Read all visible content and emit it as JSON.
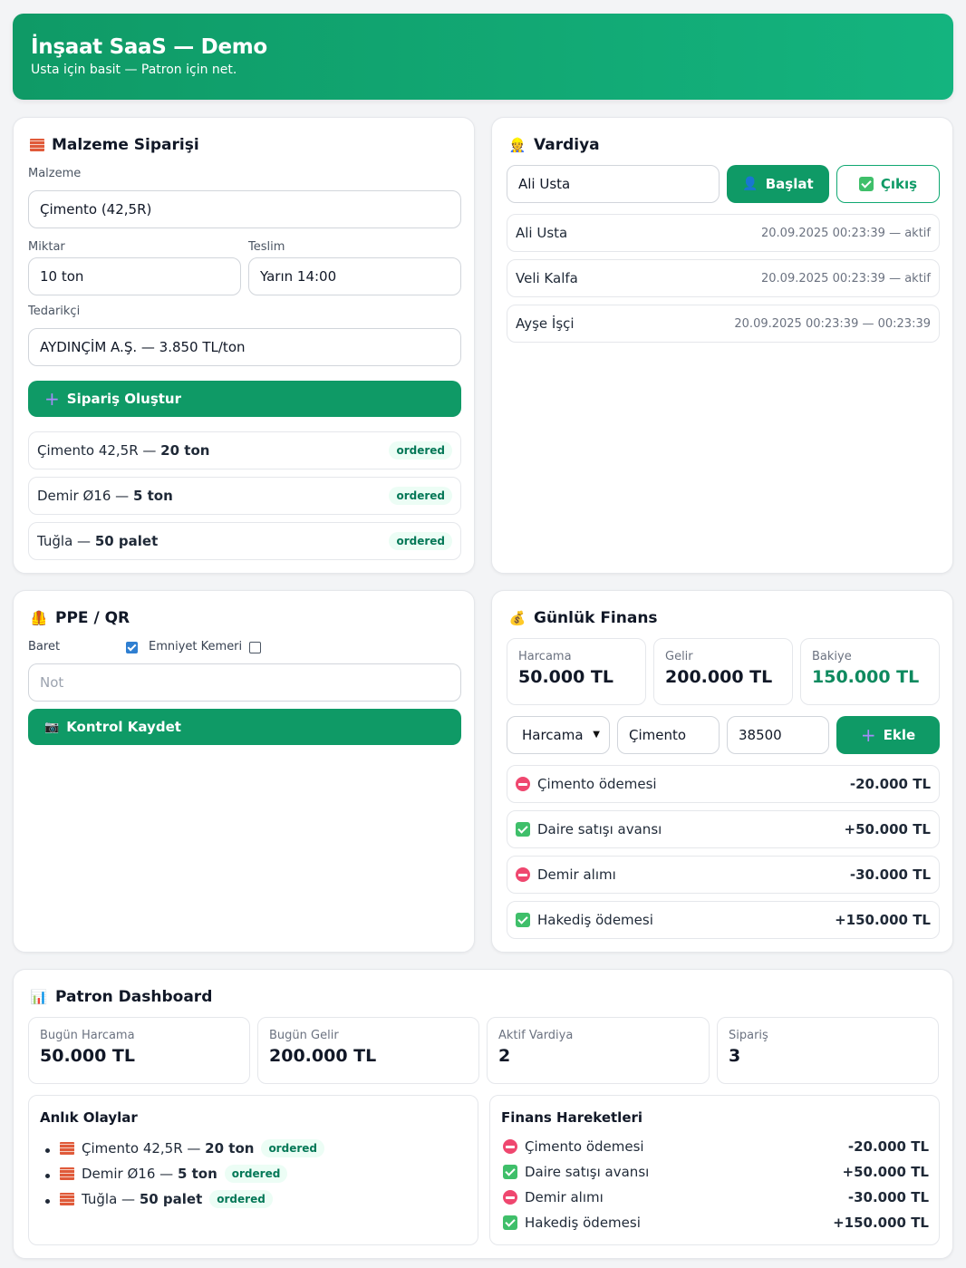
{
  "header": {
    "title": "İnşaat SaaS — Demo",
    "subtitle": "Usta için basit — Patron için net."
  },
  "order": {
    "title": "Malzeme Siparişi",
    "material_label": "Malzeme",
    "material_value": "Çimento (42,5R)",
    "qty_label": "Miktar",
    "qty_value": "10 ton",
    "delivery_label": "Teslim",
    "delivery_value": "Yarın 14:00",
    "supplier_label": "Tedarikçi",
    "supplier_value": "AYDINÇİM A.Ş. — 3.850 TL/ton",
    "create_button": "Sipariş Oluştur",
    "items": [
      {
        "name": "Çimento 42,5R — ",
        "qty": "20 ton",
        "status": "ordered"
      },
      {
        "name": "Demir Ø16 — ",
        "qty": "5 ton",
        "status": "ordered"
      },
      {
        "name": "Tuğla — ",
        "qty": "50 palet",
        "status": "ordered"
      }
    ]
  },
  "shift": {
    "title": "Vardiya",
    "name_value": "Ali Usta",
    "start_button": "Başlat",
    "exit_button": "Çıkış",
    "entries": [
      {
        "name": "Ali Usta",
        "time": "20.09.2025 00:23:39 — aktif"
      },
      {
        "name": "Veli Kalfa",
        "time": "20.09.2025 00:23:39 — aktif"
      },
      {
        "name": "Ayşe İşçi",
        "time": "20.09.2025 00:23:39 — 00:23:39"
      }
    ]
  },
  "ppe": {
    "title": "PPE / QR",
    "helmet_label": "Baret",
    "belt_label": "Emniyet Kemeri",
    "note_placeholder": "Not",
    "save_button": "Kontrol Kaydet"
  },
  "finance": {
    "title": "Günlük Finans",
    "expense_label": "Harcama",
    "expense_value": "50.000 TL",
    "income_label": "Gelir",
    "income_value": "200.000 TL",
    "balance_label": "Bakiye",
    "balance_value": "150.000 TL",
    "type_select": "Harcama",
    "desc_value": "Çimento",
    "amount_value": "38500",
    "add_button": "Ekle",
    "entries": [
      {
        "kind": "expense",
        "label": "Çimento ödemesi",
        "amount": "-20.000 TL"
      },
      {
        "kind": "income",
        "label": "Daire satışı avansı",
        "amount": "+50.000 TL"
      },
      {
        "kind": "expense",
        "label": "Demir alımı",
        "amount": "-30.000 TL"
      },
      {
        "kind": "income",
        "label": "Hakediş ödemesi",
        "amount": "+150.000 TL"
      }
    ]
  },
  "dashboard": {
    "title": "Patron Dashboard",
    "stats": [
      {
        "label": "Bugün Harcama",
        "value": "50.000 TL"
      },
      {
        "label": "Bugün Gelir",
        "value": "200.000 TL"
      },
      {
        "label": "Aktif Vardiya",
        "value": "2"
      },
      {
        "label": "Sipariş",
        "value": "3"
      }
    ],
    "events_title": "Anlık Olaylar",
    "events": [
      {
        "name": "Çimento 42,5R — ",
        "qty": "20 ton",
        "status": "ordered"
      },
      {
        "name": "Demir Ø16 — ",
        "qty": "5 ton",
        "status": "ordered"
      },
      {
        "name": "Tuğla — ",
        "qty": "50 palet",
        "status": "ordered"
      }
    ],
    "moves_title": "Finans Hareketleri",
    "moves": [
      {
        "kind": "expense",
        "label": "Çimento ödemesi",
        "amount": "-20.000 TL"
      },
      {
        "kind": "income",
        "label": "Daire satışı avansı",
        "amount": "+50.000 TL"
      },
      {
        "kind": "expense",
        "label": "Demir alımı",
        "amount": "-30.000 TL"
      },
      {
        "kind": "income",
        "label": "Hakediş ödemesi",
        "amount": "+150.000 TL"
      }
    ]
  }
}
